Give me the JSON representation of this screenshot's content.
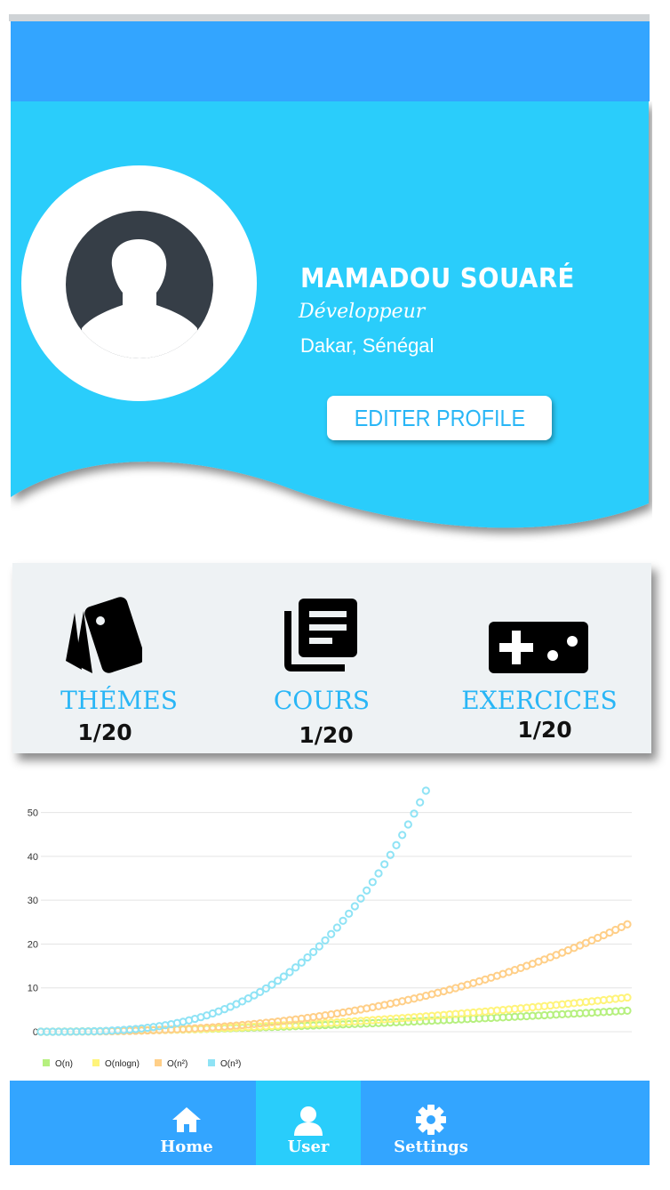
{
  "profile": {
    "name": "Mamadou Souaré",
    "job": "Développeur",
    "location": "Dakar, Sénégal",
    "edit_label": "EDITER PROFILE",
    "avatar_icon": "user-silhouette-icon"
  },
  "stats": [
    {
      "label": "THÉMES",
      "value": "1/20",
      "icon": "cards-icon"
    },
    {
      "label": "COURS",
      "value": "1/20",
      "icon": "library-books-icon"
    },
    {
      "label": "EXERCICES",
      "value": "1/20",
      "icon": "gamepad-icon"
    }
  ],
  "chart_data": {
    "type": "line",
    "y_ticks": [
      "0",
      "10",
      "20",
      "30",
      "40",
      "50"
    ],
    "ylim": [
      0,
      55
    ],
    "x_points": 100,
    "series": [
      {
        "name": "O(n)",
        "color": "#b6f07f",
        "end_value": 4.8
      },
      {
        "name": "O(nlogn)",
        "color": "#fff47a",
        "end_value": 7.8
      },
      {
        "name": "O(n²)",
        "color": "#ffcf88",
        "end_value": 24.5
      },
      {
        "name": "O(n³)",
        "color": "#8fe3f5",
        "end_value": 55
      }
    ],
    "grid": true,
    "legend_position": "bottom-left"
  },
  "nav": {
    "items": [
      {
        "label": "Home",
        "icon": "home-icon"
      },
      {
        "label": "User",
        "icon": "user-icon",
        "active": true
      },
      {
        "label": "Settings",
        "icon": "gear-icon"
      }
    ]
  },
  "colors": {
    "app_bar": "#33a5ff",
    "hero": "#29cdfb",
    "accent": "#29b6f6",
    "nav": "#33a5ff",
    "nav_active": "#29cdfb"
  }
}
